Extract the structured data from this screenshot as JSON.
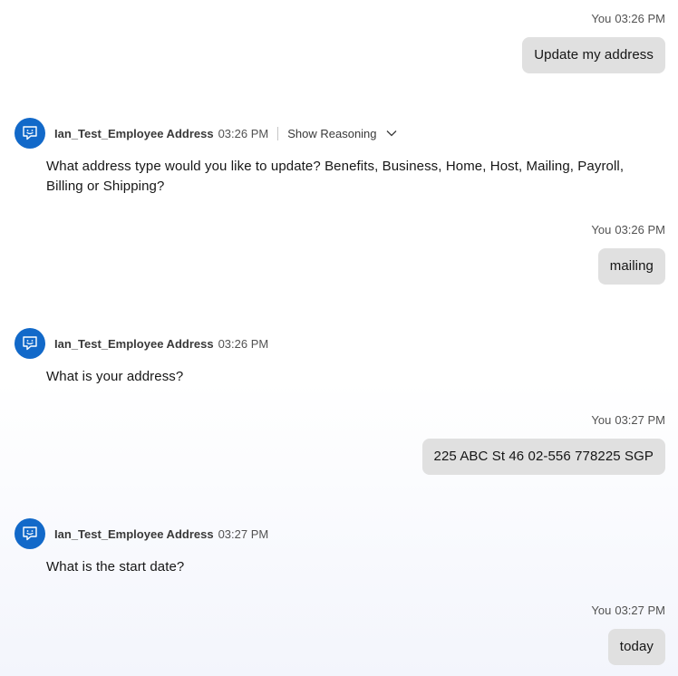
{
  "messages": [
    {
      "role": "user",
      "sender": "You",
      "time": "03:26 PM",
      "text": "Update my address"
    },
    {
      "role": "bot",
      "sender": "Ian_Test_Employee Address",
      "time": "03:26 PM",
      "reasoning_label": "Show Reasoning",
      "text": "What address type would you like to update? Benefits, Business, Home, Host, Mailing, Payroll, Billing or Shipping?"
    },
    {
      "role": "user",
      "sender": "You",
      "time": "03:26 PM",
      "text": "mailing"
    },
    {
      "role": "bot",
      "sender": "Ian_Test_Employee Address",
      "time": "03:26 PM",
      "text": "What is your address?"
    },
    {
      "role": "user",
      "sender": "You",
      "time": "03:27 PM",
      "text": "225 ABC St 46 02-556 778225 SGP"
    },
    {
      "role": "bot",
      "sender": "Ian_Test_Employee Address",
      "time": "03:27 PM",
      "text": "What is the start date?"
    },
    {
      "role": "user",
      "sender": "You",
      "time": "03:27 PM",
      "text": "today"
    }
  ],
  "colors": {
    "avatar": "#1269c9",
    "user_bubble": "#e0e0e0",
    "text": "#161616",
    "muted": "#525252"
  },
  "icons": {
    "avatar": "chat-bot-icon",
    "reasoning_toggle": "chevron-down-icon"
  }
}
